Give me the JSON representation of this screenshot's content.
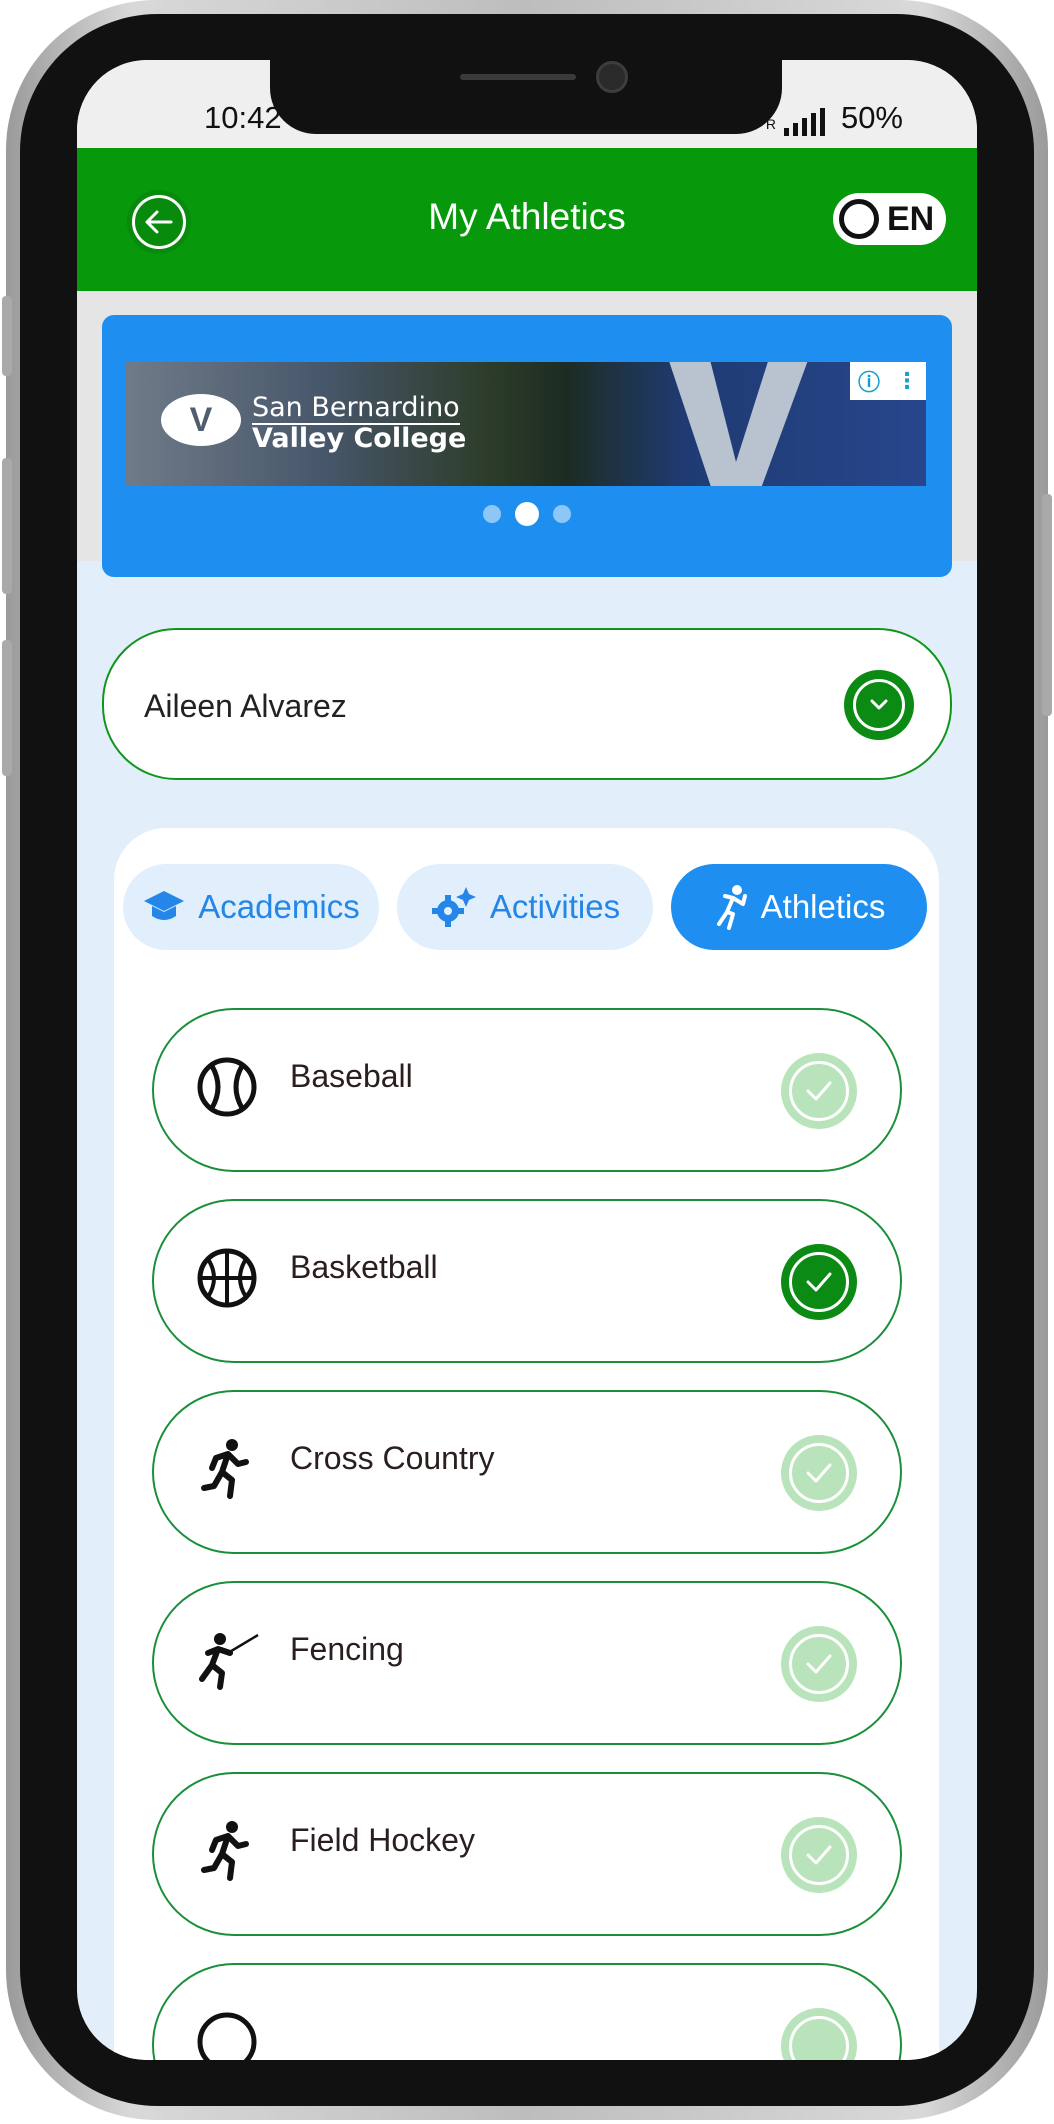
{
  "status_bar": {
    "time": "10:42",
    "network": "R",
    "battery": "50%"
  },
  "header": {
    "title": "My Athletics",
    "language": "EN"
  },
  "banner": {
    "ad_line1": "San Bernardino",
    "ad_line2": "Valley College",
    "ad_badge_info": "ⓘ",
    "ad_badge_menu": "⋮",
    "slide_count": 3,
    "active_slide": 2
  },
  "student_select": {
    "selected": "Aileen Alvarez"
  },
  "tabs": [
    {
      "label": "Academics",
      "icon": "graduation-cap-icon",
      "active": false
    },
    {
      "label": "Activities",
      "icon": "gears-icon",
      "active": false
    },
    {
      "label": "Athletics",
      "icon": "athlete-icon",
      "active": true
    }
  ],
  "sports": [
    {
      "name": "Baseball",
      "icon": "baseball-icon",
      "selected": false
    },
    {
      "name": "Basketball",
      "icon": "basketball-icon",
      "selected": true
    },
    {
      "name": "Cross Country",
      "icon": "runner-icon",
      "selected": false
    },
    {
      "name": "Fencing",
      "icon": "fencing-icon",
      "selected": false
    },
    {
      "name": "Field Hockey",
      "icon": "runner-icon",
      "selected": false
    },
    {
      "name": "",
      "icon": "ball-icon",
      "selected": false
    }
  ],
  "colors": {
    "app_bar": "#07980c",
    "banner": "#1e8ff0",
    "accent_green": "#0b8a14",
    "check_unselected": "#b9e4bb",
    "screen_bg": "#e2effa"
  }
}
